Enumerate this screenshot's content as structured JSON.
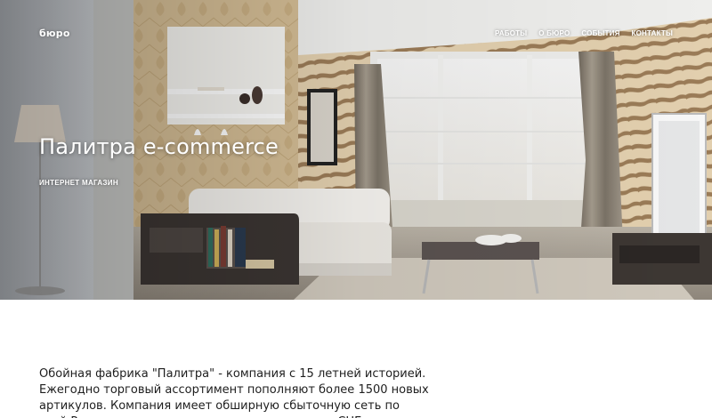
{
  "header": {
    "logo": "бюро",
    "nav": [
      {
        "label": "РАБОТЫ"
      },
      {
        "label": "О БЮРО"
      },
      {
        "label": "СОБЫТИЯ"
      },
      {
        "label": "КОНТАКТЫ"
      }
    ]
  },
  "hero": {
    "title": "Палитра e-commerce",
    "subtitle": "ИНТЕРНЕТ МАГАЗИН"
  },
  "content": {
    "text": "Обойная фабрика \"Палитра\" - компания с 15 летней историей. Ежегодно торговый ассортимент пополняют более 1500 новых артикулов. Компания имеет обширную сбыточную сеть по всей России, а также дилерскую сеть в странах СНГ и"
  }
}
